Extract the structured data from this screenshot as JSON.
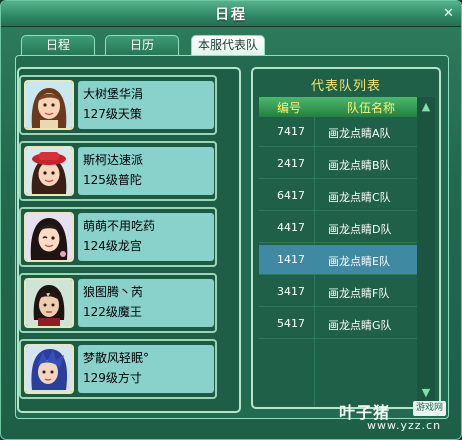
{
  "window": {
    "title": "日程",
    "close_glyph": "✕"
  },
  "tabs": [
    {
      "label": "日程",
      "active": false
    },
    {
      "label": "日历",
      "active": false
    },
    {
      "label": "本服代表队",
      "active": true
    }
  ],
  "members": [
    {
      "name": "大树堡华涓",
      "level": "127级天策",
      "avatar": "girl-brown-hair-icon"
    },
    {
      "name": "斯柯达速派",
      "level": "125级普陀",
      "avatar": "girl-red-hat-icon"
    },
    {
      "name": "萌萌不用吃药",
      "level": "124级龙宫",
      "avatar": "girl-winking-icon"
    },
    {
      "name": "狼图腾丶芮",
      "level": "122级魔王",
      "avatar": "boy-dark-hair-icon"
    },
    {
      "name": "梦散风轻眠°",
      "level": "129级方寸",
      "avatar": "boy-blue-hair-icon"
    }
  ],
  "team_list": {
    "title": "代表队列表",
    "headers": {
      "number": "编号",
      "team_name": "队伍名称"
    },
    "rows": [
      {
        "number": "7417",
        "team": "画龙点睛A队",
        "selected": false
      },
      {
        "number": "2417",
        "team": "画龙点睛B队",
        "selected": false
      },
      {
        "number": "6417",
        "team": "画龙点睛C队",
        "selected": false
      },
      {
        "number": "4417",
        "team": "画龙点睛D队",
        "selected": false
      },
      {
        "number": "1417",
        "team": "画龙点睛E队",
        "selected": true
      },
      {
        "number": "3417",
        "team": "画龙点睛F队",
        "selected": false
      },
      {
        "number": "5417",
        "team": "画龙点睛G队",
        "selected": false
      }
    ],
    "scroll_up_glyph": "▲",
    "scroll_down_glyph": "▼"
  },
  "watermark": {
    "main": "叶子猪",
    "box": "游戏网",
    "url": "www.yzz.cn"
  },
  "colors": {
    "accent_title": "#f4e36c",
    "selected_row": "#3f89a3",
    "header_text": "#fff46b"
  }
}
